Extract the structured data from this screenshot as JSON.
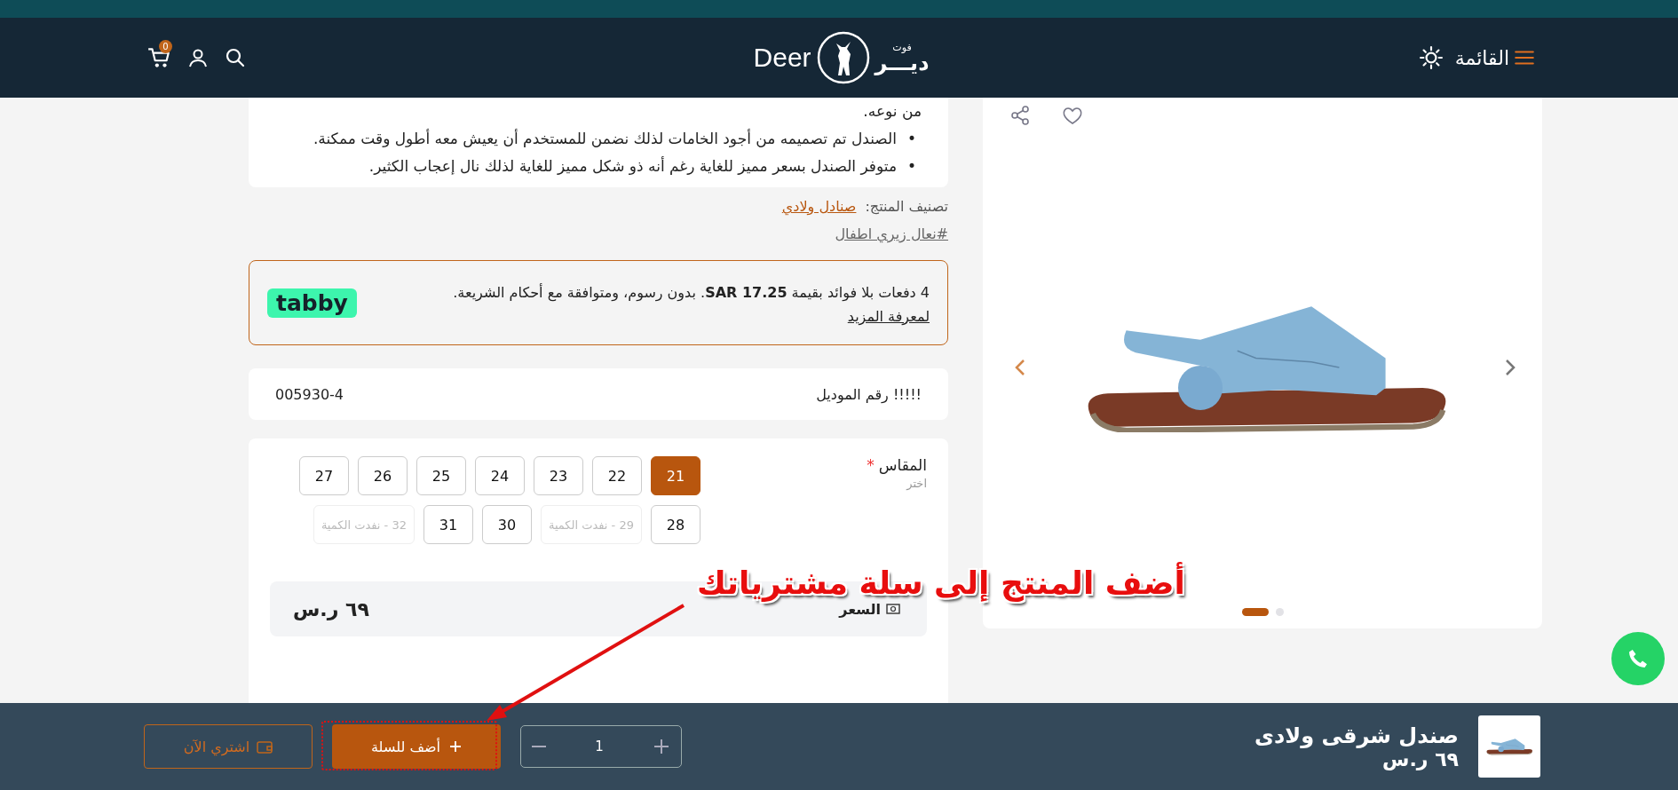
{
  "header": {
    "menu_label": "القائمة",
    "logo_arabic": "ديـــر",
    "logo_arabic_small": "فوت",
    "logo_latin": "Deer",
    "cart_count": "0"
  },
  "gallery": {
    "dots": [
      {
        "selected": false
      },
      {
        "selected": true
      }
    ]
  },
  "description": {
    "continuation": "من نوعه.",
    "bullets": [
      {
        "marker": "•",
        "text": "الصندل تم تصميمه من أجود الخامات لذلك نضمن للمستخدم أن يعيش معه أطول وقت ممكنة."
      },
      {
        "marker": "•",
        "text": "متوفر الصندل بسعر مميز للغاية رغم أنه ذو شكل مميز للغاية لذلك نال إعجاب الكثير."
      }
    ]
  },
  "category": {
    "label": "تصنيف المنتج:",
    "value": "صنادل ولادي",
    "tag": "#نعال زيري اطفال"
  },
  "tabby": {
    "text": "4 دفعات بلا فوائد بقيمة **SAR 17.25**. بدون رسوم، ومتوافقة مع أحكام الشريعة.",
    "link": "لمعرفة المزيد",
    "logo": "tabby"
  },
  "model": {
    "label": "!!!!! رقم الموديل",
    "value": "005930-4"
  },
  "sizes": {
    "label": "المقاس",
    "required_mark": "*",
    "hint": "اختر",
    "options": [
      {
        "label": "21",
        "selected": true,
        "disabled": false
      },
      {
        "label": "22",
        "selected": false,
        "disabled": false
      },
      {
        "label": "23",
        "selected": false,
        "disabled": false
      },
      {
        "label": "24",
        "selected": false,
        "disabled": false
      },
      {
        "label": "25",
        "selected": false,
        "disabled": false
      },
      {
        "label": "26",
        "selected": false,
        "disabled": false
      },
      {
        "label": "27",
        "selected": false,
        "disabled": false
      },
      {
        "label": "28",
        "selected": false,
        "disabled": false
      },
      {
        "label": "29 - نفدت الكمية",
        "selected": false,
        "disabled": true
      },
      {
        "label": "30",
        "selected": false,
        "disabled": false
      },
      {
        "label": "31",
        "selected": false,
        "disabled": false
      },
      {
        "label": "32 - نفدت الكمية",
        "selected": false,
        "disabled": true
      }
    ]
  },
  "price": {
    "label": "السعر",
    "value": "٦٩ ر.س"
  },
  "cart_bar": {
    "product_name": "صندل شرقى ولادى",
    "price": "٦٩ ر.س",
    "quantity": "1",
    "add_button": "أضف للسلة",
    "buy_button": "اشتري الآن"
  },
  "annotation": {
    "text": "أضف المنتج إلى سلة مشترياتك"
  }
}
